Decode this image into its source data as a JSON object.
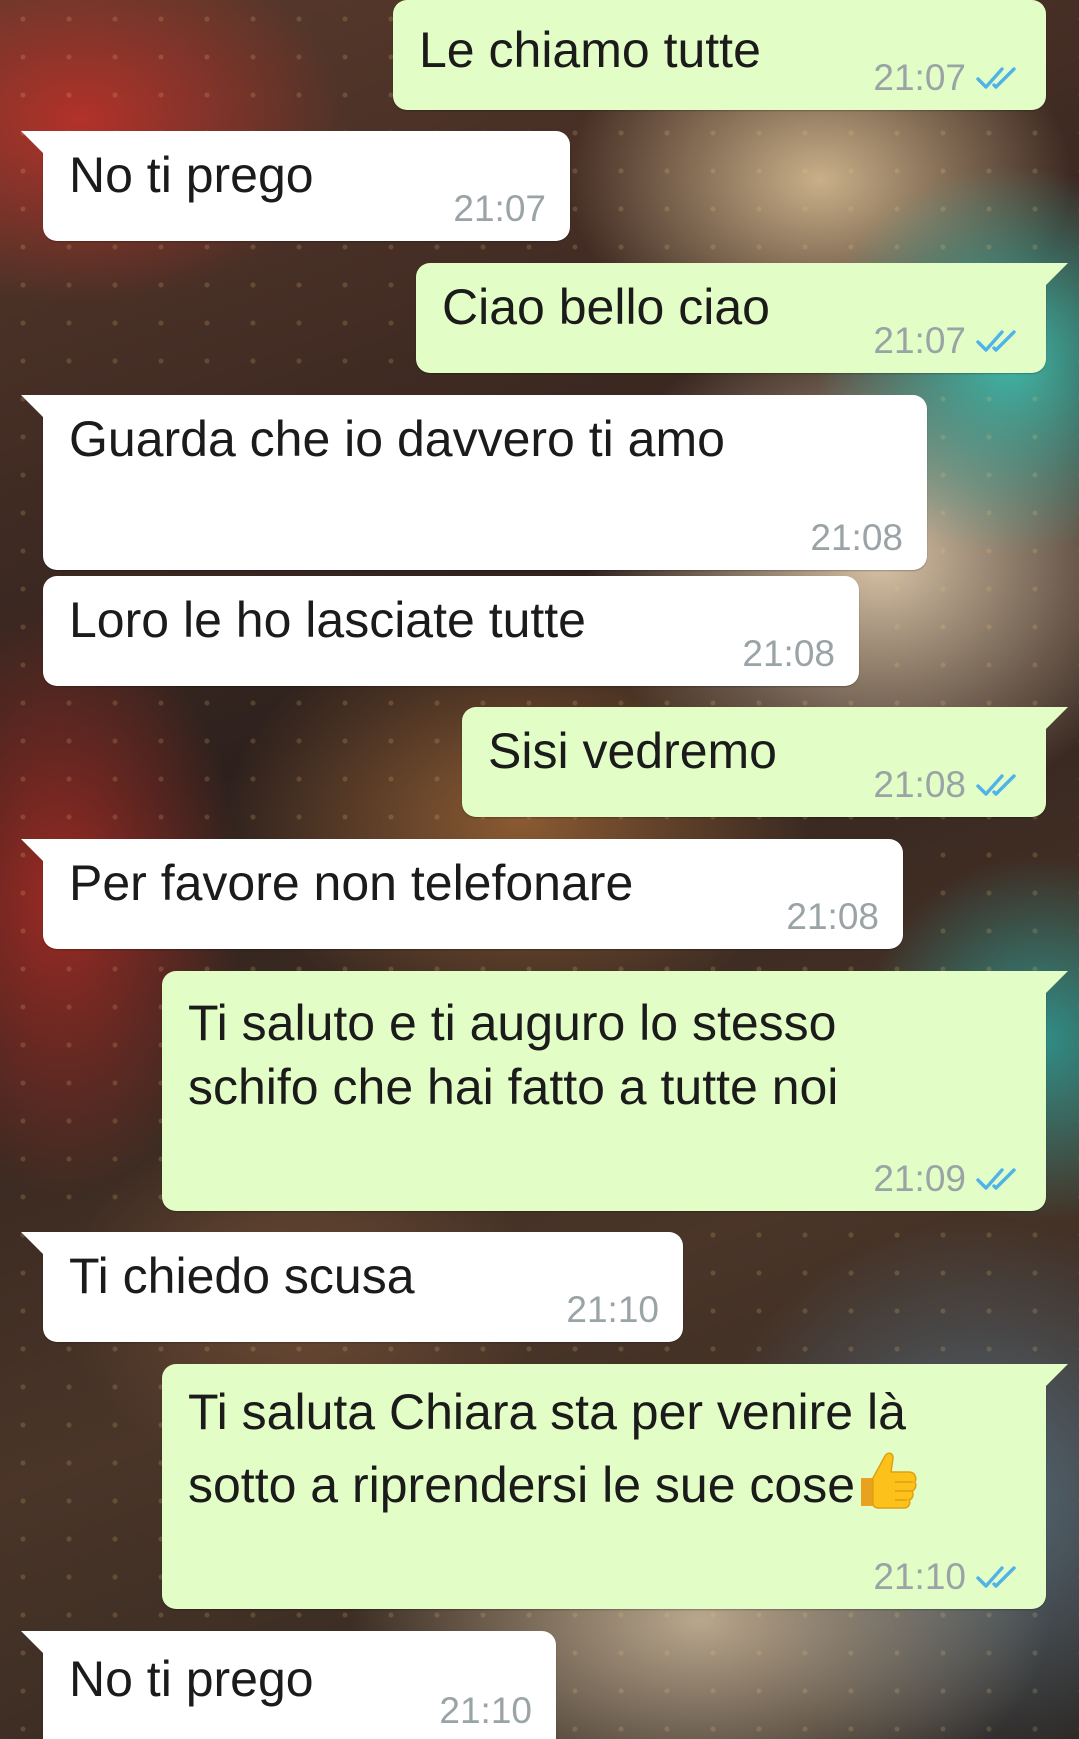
{
  "chat": {
    "messages": [
      {
        "direction": "out",
        "text": "Le chiamo tutte",
        "time": "21:07",
        "status": "read-double-check"
      },
      {
        "direction": "in",
        "text": "No ti prego",
        "time": "21:07"
      },
      {
        "direction": "out",
        "text": "Ciao bello ciao",
        "time": "21:07",
        "status": "read-double-check"
      },
      {
        "direction": "in",
        "text": "Guarda che io davvero ti amo",
        "time": "21:08"
      },
      {
        "direction": "in",
        "text": "Loro le ho lasciate tutte",
        "time": "21:08"
      },
      {
        "direction": "out",
        "text": "Sisi vedremo",
        "time": "21:08",
        "status": "read-double-check"
      },
      {
        "direction": "in",
        "text": "Per favore non telefonare",
        "time": "21:08"
      },
      {
        "direction": "out",
        "line1": "Ti saluto e ti auguro lo stesso",
        "line2": "schifo che hai fatto a tutte noi",
        "time": "21:09",
        "status": "read-double-check"
      },
      {
        "direction": "in",
        "text": "Ti chiedo scusa",
        "time": "21:10"
      },
      {
        "direction": "out",
        "line1": "Ti saluta Chiara sta per venire là",
        "line2": "sotto a riprendersi le sue cose",
        "emoji": "thumbs-up-emoji",
        "time": "21:10",
        "status": "read-double-check"
      },
      {
        "direction": "in",
        "text": "No ti prego",
        "time": "21:10"
      }
    ]
  },
  "colors": {
    "incoming_bubble": "#ffffff",
    "outgoing_bubble": "#e3fdc6",
    "timestamp": "#9aa3a5",
    "read_ticks": "#4fb3e8"
  },
  "icons": {
    "read_receipt": "double-check-icon",
    "emoji": "thumbs-up-emoji"
  }
}
